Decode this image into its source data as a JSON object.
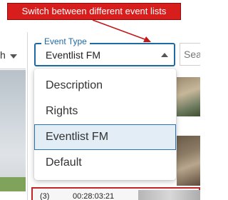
{
  "annotation": {
    "text": "Switch between different event lists",
    "color": "#d81d1d"
  },
  "left_dropdown": {
    "text": "h"
  },
  "event_type": {
    "label": "Event Type",
    "value": "Eventlist FM",
    "accent": "#1f6aa5",
    "options": [
      {
        "label": "Description",
        "selected": false
      },
      {
        "label": "Rights",
        "selected": false
      },
      {
        "label": "Eventlist FM",
        "selected": true
      },
      {
        "label": "Default",
        "selected": false
      }
    ]
  },
  "search": {
    "placeholder": "Sea"
  },
  "event_row": {
    "index": "(3)",
    "timecode": "00:28:03:21"
  }
}
